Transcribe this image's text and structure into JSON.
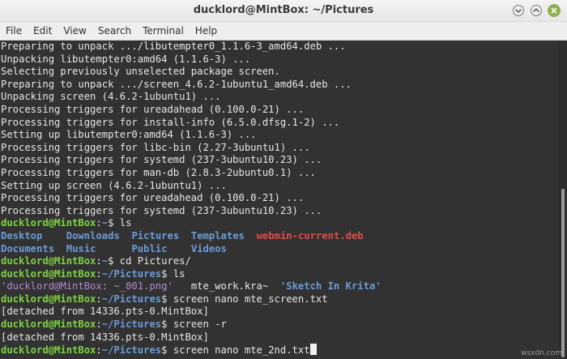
{
  "window": {
    "title": "ducklord@MintBox: ~/Pictures"
  },
  "menu": [
    "File",
    "Edit",
    "View",
    "Search",
    "Terminal",
    "Help"
  ],
  "output_lines": [
    "Preparing to unpack .../libutempter0_1.1.6-3_amd64.deb ...",
    "Unpacking libutempter0:amd64 (1.1.6-3) ...",
    "Selecting previously unselected package screen.",
    "Preparing to unpack .../screen_4.6.2-1ubuntu1_amd64.deb ...",
    "Unpacking screen (4.6.2-1ubuntu1) ...",
    "Processing triggers for ureadahead (0.100.0-21) ...",
    "Processing triggers for install-info (6.5.0.dfsg.1-2) ...",
    "Setting up libutempter0:amd64 (1.1.6-3) ...",
    "Processing triggers for libc-bin (2.27-3ubuntu1) ...",
    "Processing triggers for systemd (237-3ubuntu10.23) ...",
    "Processing triggers for man-db (2.8.3-2ubuntu0.1) ...",
    "Setting up screen (4.6.2-1ubuntu1) ...",
    "Processing triggers for ureadahead (0.100.0-21) ...",
    "Processing triggers for systemd (237-3ubuntu10.23) ..."
  ],
  "prompt": {
    "user": "ducklord@MintBox",
    "sep": ":",
    "home_path": "~",
    "pictures_path": "~/Pictures",
    "dollar": "$ "
  },
  "commands": {
    "ls": "ls",
    "cd": "cd Pictures/",
    "screen_nano_1": "screen nano mte_screen.txt",
    "screen_r": "screen -r",
    "screen_nano_2": "screen nano mte_2nd.txt"
  },
  "ls_home": {
    "row1": [
      "Desktop",
      "Downloads",
      "Pictures",
      "Templates"
    ],
    "row1_deb": "webmin-current.deb",
    "row2": [
      "Documents",
      "Music",
      "Public",
      "Videos"
    ]
  },
  "ls_pictures": {
    "file1": "'ducklord@MintBox: ~_001.png'",
    "file2": "mte_work.kra~",
    "file3": "'Sketch In Krita'"
  },
  "detached_1": "[detached from 14336.pts-0.MintBox]",
  "detached_2": "[detached from 14336.pts-0.MintBox]",
  "watermark": "wsxdn.com",
  "colors": {
    "terminal_bg": "#323232",
    "prompt_user": "#7fd243",
    "prompt_path": "#6b9bd8",
    "deb_file": "#e24a47",
    "image_file": "#b48ad1"
  }
}
